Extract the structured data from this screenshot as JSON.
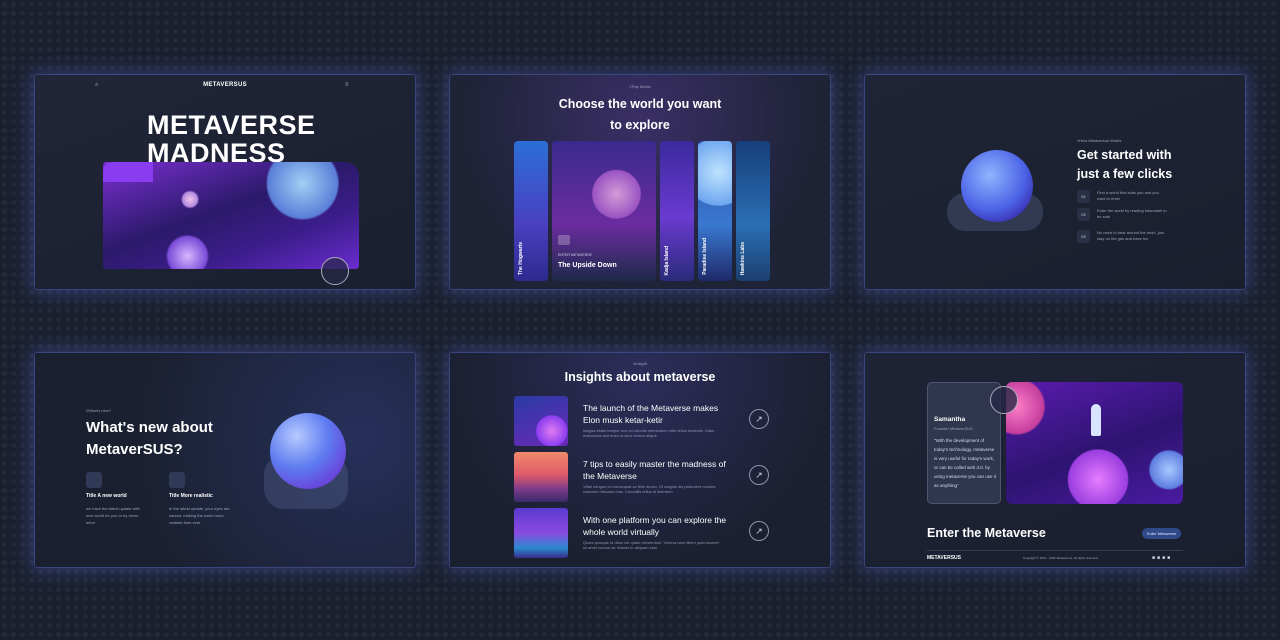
{
  "panel1": {
    "brand": "METAVERSUS",
    "title_line1": "METAVERSE",
    "title_line2": "MADNESS"
  },
  "panel2": {
    "eyebrow": "//Pay Model",
    "title_line1": "Choose the world you want",
    "title_line2": "to explore",
    "cards": [
      {
        "label": "The Hogwarts"
      },
      {
        "eyebrow": "ENTER METAVERSE",
        "label": "The Upside Down"
      },
      {
        "label": "Kadja Island"
      },
      {
        "label": "Paradise Island"
      },
      {
        "label": "Hawkins Labs"
      }
    ]
  },
  "panel3": {
    "eyebrow": "//How Metaversus Works",
    "title_line1": "Get started with",
    "title_line2": "just a few clicks",
    "steps": [
      {
        "num": "01",
        "text": "Find a world that suits you and you want to enter"
      },
      {
        "num": "02",
        "text": "Enter the world by reading basmalah to be safe"
      },
      {
        "num": "03",
        "text": "No need to beat around the bush, just stay on the gas and have fun"
      }
    ]
  },
  "panel4": {
    "eyebrow": "//What's new?",
    "title_line1": "What's new about",
    "title_line2": "MetaverSUS?",
    "features": [
      {
        "title": "Title A new world",
        "text": "we have the latest update with new world for you to try never mind"
      },
      {
        "title": "Title More realistic",
        "text": "In the latest update, your eyes are narrow, making the world more realistic than ever"
      }
    ]
  },
  "panel5": {
    "eyebrow": "//Insight",
    "title": "Insights about metaverse",
    "items": [
      {
        "title": "The launch of the Metaverse makes Elon musk ketar-ketir",
        "desc": "Magna etiam tempor orci eu lobortis elementum nibh tellus molestie. Diam maecenas sed enim ut sem viverra alique."
      },
      {
        "title": "7 tips to easily master the madness of the Metaverse",
        "desc": "Vitae congue eu consequat ac felis donec. Et magnis dis parturient montes nascetur ridiculus mus. Convallis tellus id interdum"
      },
      {
        "title": "With one platform you can explore the whole world virtually",
        "desc": "Quam quisque id diam vel quam elementum. Viverra nam libero justo laoreet sit amet cursus sit. Mauris in aliquam sem"
      }
    ]
  },
  "panel6": {
    "name": "Samantha",
    "role": "Founder MetaverSUS",
    "quote": "\"With the development of today's technology, metaverse is very useful for today's work, or can be called web 3.0. by using metaverse you can use it as anything\"",
    "cta_title": "Enter the Metaverse",
    "cta_button": "Enter Metaverse",
    "footer_brand": "METAVERSUS",
    "copyright": "Copyright © 2021 - 2022 Metaversus. All rights reserved."
  },
  "colors": {
    "background": "#1b2030",
    "accent": "#8a3cf0",
    "glow": "#5a6edc"
  }
}
